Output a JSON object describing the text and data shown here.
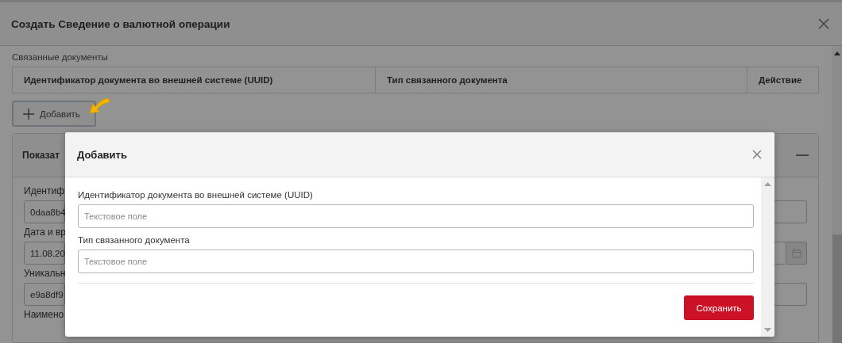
{
  "dialog": {
    "title": "Создать Сведение о валютной операции",
    "section_label": "Связанные документы",
    "table": {
      "columns": [
        "Идентификатор документа во внешней системе (UUID)",
        "Тип связанного документа",
        "Действие"
      ]
    },
    "add_button": "Добавить",
    "panel": {
      "title": "Показат",
      "fields": [
        {
          "label": "Идентиф",
          "value": "0daa8b4",
          "kind": "text"
        },
        {
          "label": "Дата и вр",
          "value": "11.08.20",
          "kind": "date"
        },
        {
          "label": "Уникальн",
          "value": "e9a8df9",
          "kind": "text"
        },
        {
          "label": "Наимено",
          "kind": "label"
        }
      ]
    }
  },
  "modal": {
    "title": "Добавить",
    "fields": [
      {
        "label": "Идентификатор документа во внешней системе (UUID)",
        "placeholder": "Текстовое поле"
      },
      {
        "label": "Тип связанного документа",
        "placeholder": "Текстовое поле"
      }
    ],
    "save_button": "Сохранить"
  }
}
